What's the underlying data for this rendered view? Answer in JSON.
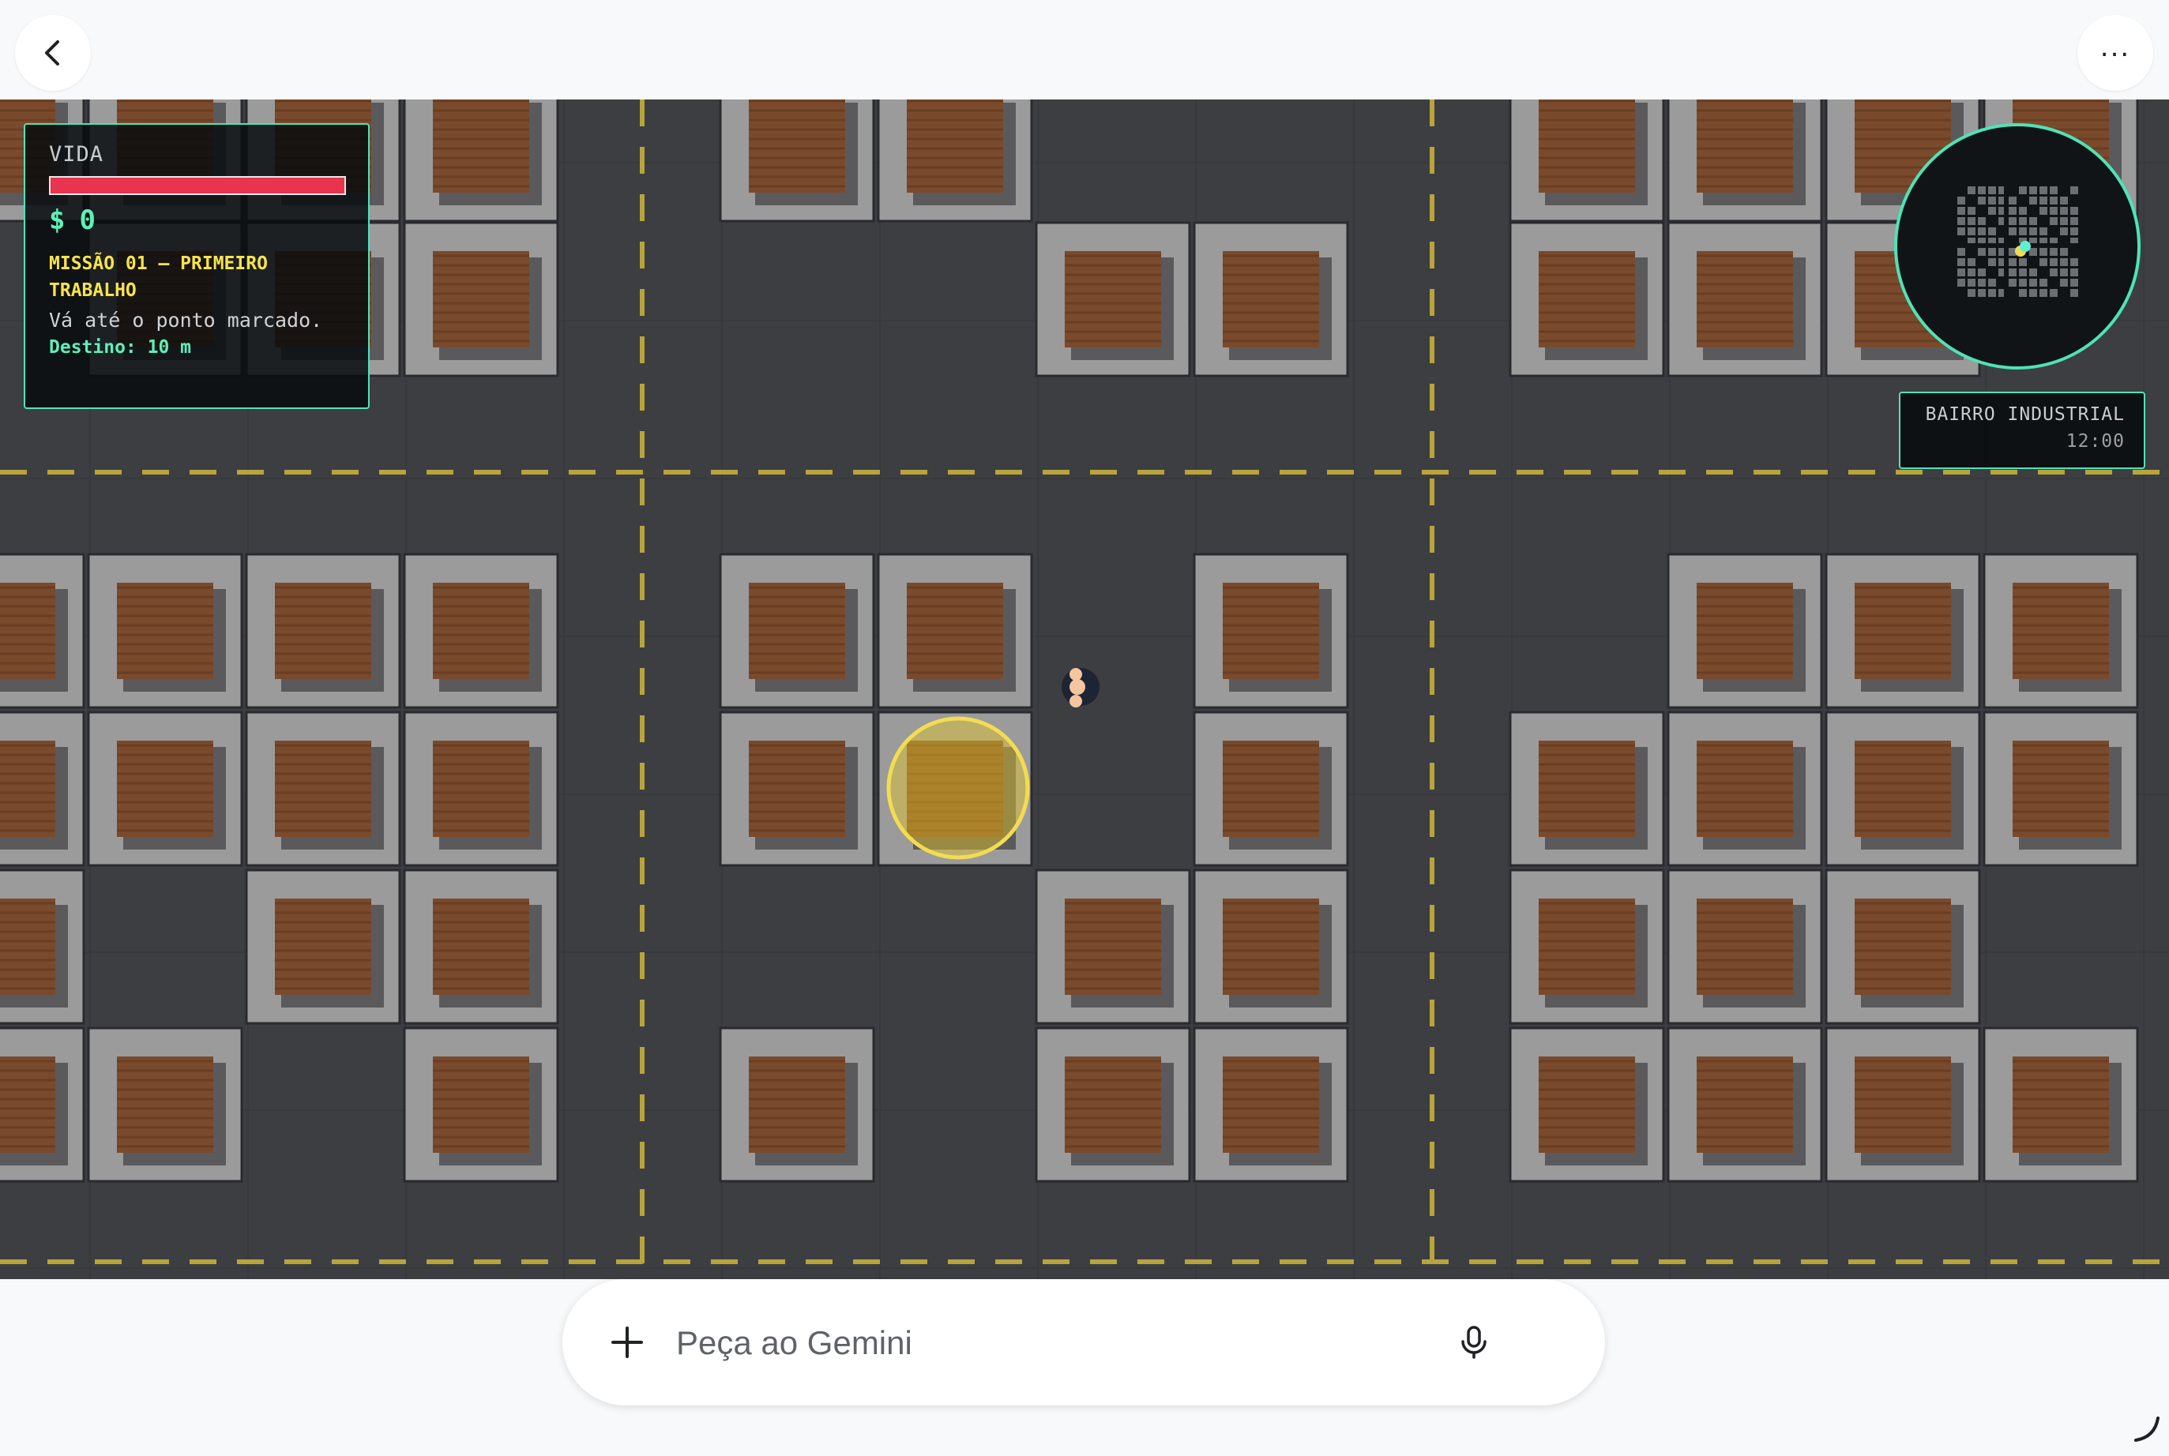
{
  "app": {
    "back_icon": "chevron-left-icon",
    "more_icon": "more-horizontal-icon",
    "more_label": "..."
  },
  "hud": {
    "health_label": "VIDA",
    "health_fraction": 1.0,
    "money_symbol": "$",
    "money_value": "0",
    "mission_title": "MISSÃO 01 — PRIMEIRO TRABALHO",
    "mission_description": "Vá até o ponto marcado.",
    "destination": "Destino: 10 m"
  },
  "location": {
    "name": "BAIRRO INDUSTRIAL",
    "time": "12:00"
  },
  "prompt": {
    "placeholder": "Peça ao Gemini",
    "add_icon": "plus-icon",
    "mic_icon": "microphone-icon"
  },
  "colors": {
    "accent": "#4ee3b8",
    "health": "#e8344f",
    "mission": "#f7e44a",
    "road": "#3d3e42",
    "lane_marking": "#b8a43a",
    "roof": "#7a4a2c"
  }
}
